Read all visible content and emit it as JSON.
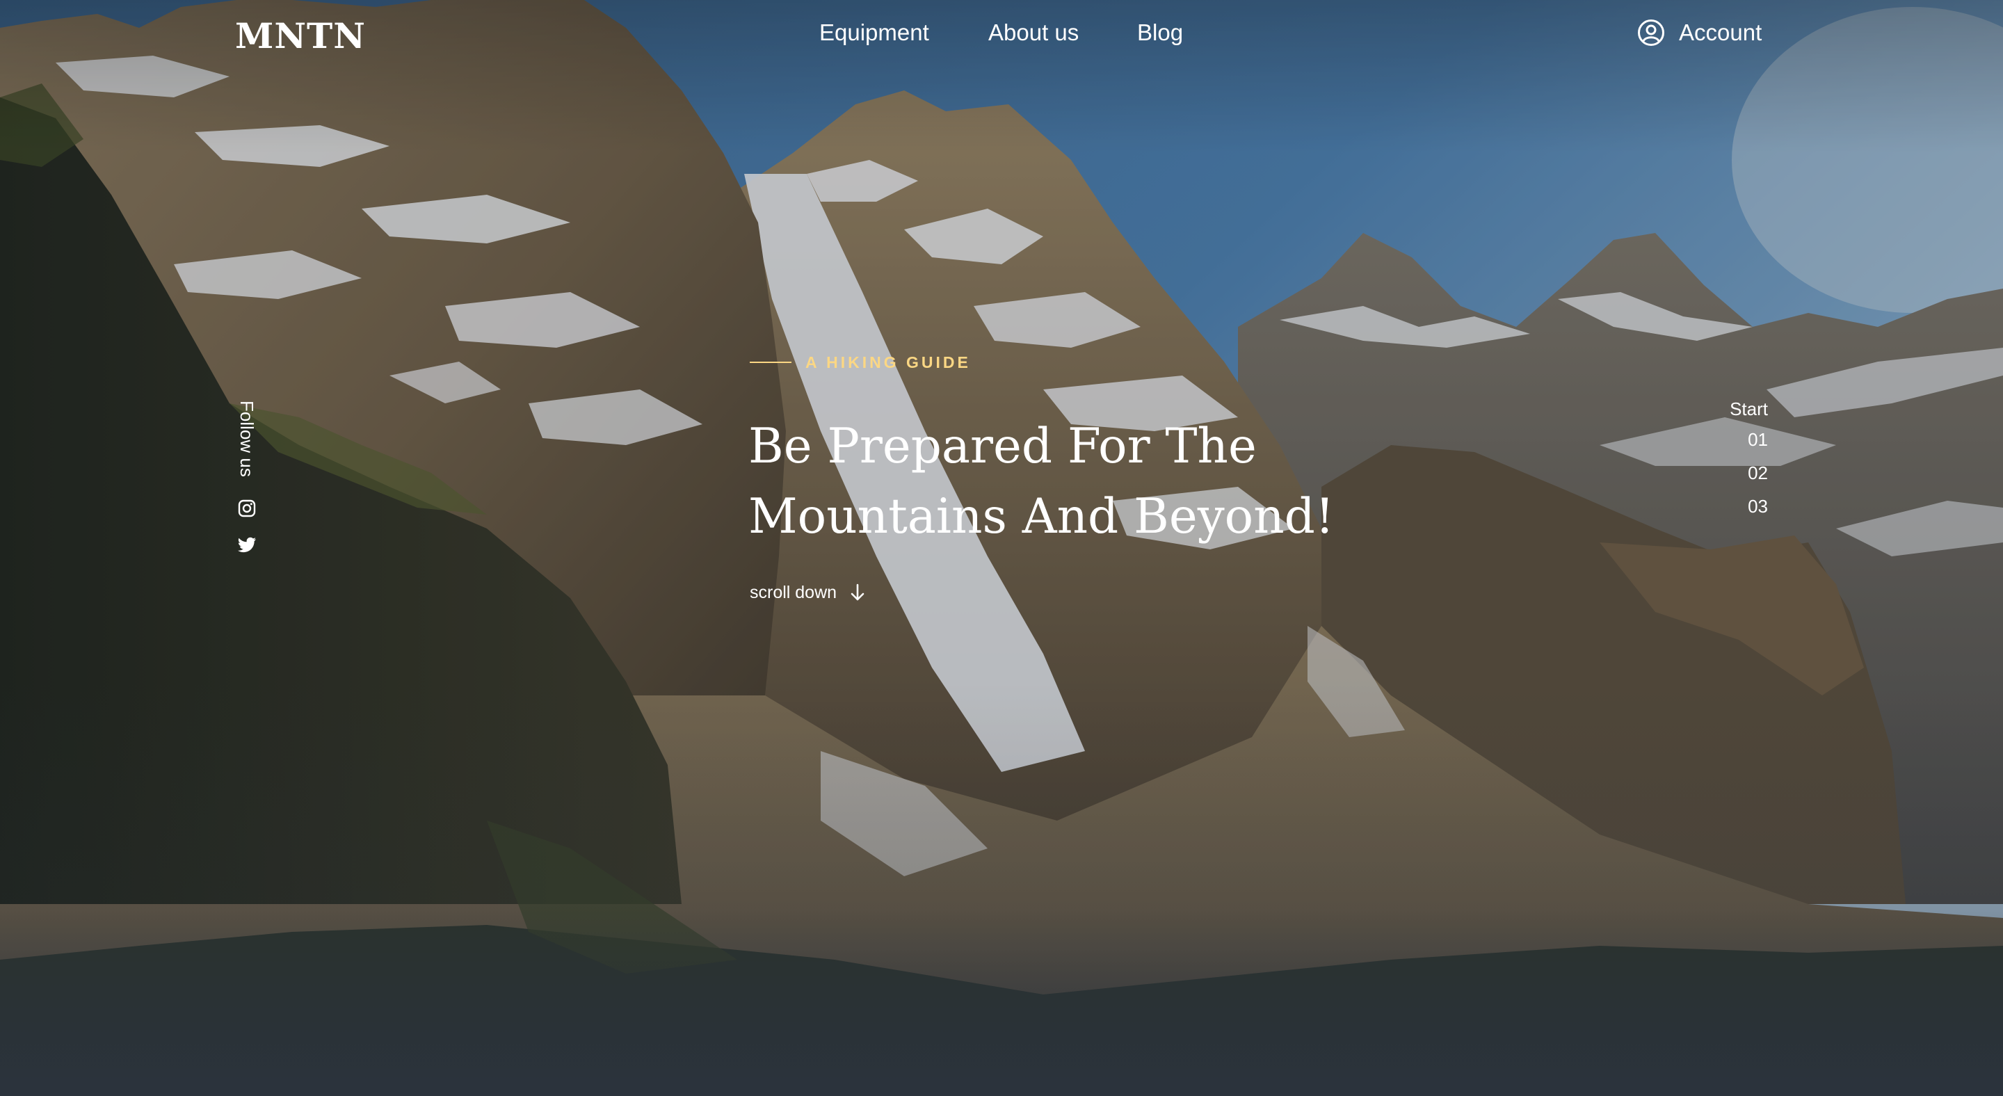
{
  "header": {
    "logo": "MNTN",
    "nav": [
      {
        "label": "Equipment"
      },
      {
        "label": "About us"
      },
      {
        "label": "Blog"
      }
    ],
    "account_label": "Account"
  },
  "social": {
    "follow_label": "Follow us",
    "icons": [
      "instagram-icon",
      "twitter-icon"
    ]
  },
  "hero": {
    "eyebrow": "A HIKING GUIDE",
    "headline_line1": "Be Prepared For The",
    "headline_line2": "Mountains And Beyond!",
    "scroll_label": "scroll down"
  },
  "slider": {
    "label": "Start",
    "items": [
      "01",
      "02",
      "03"
    ]
  },
  "colors": {
    "accent": "#fbd784",
    "text": "#ffffff",
    "bottom_fade": "#2b333d"
  }
}
